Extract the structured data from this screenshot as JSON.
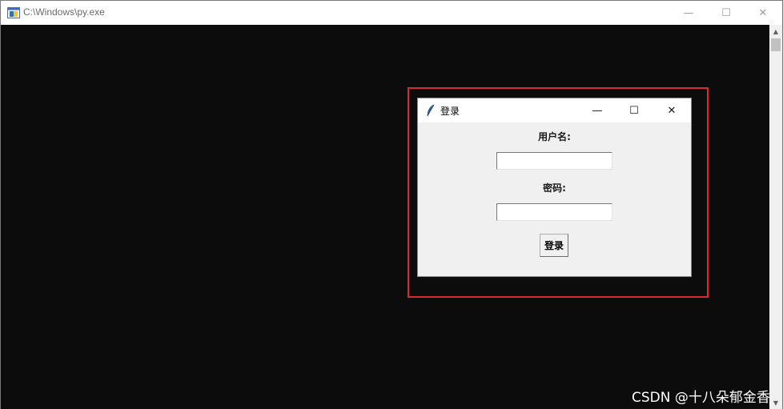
{
  "console": {
    "title": "C:\\Windows\\py.exe",
    "icon": "python-console-icon",
    "controls": {
      "minimize": "—",
      "maximize": "☐",
      "close": "✕"
    },
    "background": "#0c0c0c"
  },
  "dialog": {
    "title": "登录",
    "icon": "tk-feather-icon",
    "controls": {
      "minimize": "—",
      "maximize": "☐",
      "close": "✕"
    },
    "username_label": "用户名:",
    "username_value": "",
    "password_label": "密码:",
    "password_value": "",
    "login_button": "登录"
  },
  "highlight": {
    "color": "#d92b2b"
  },
  "watermark": "CSDN @十八朵郁金香"
}
